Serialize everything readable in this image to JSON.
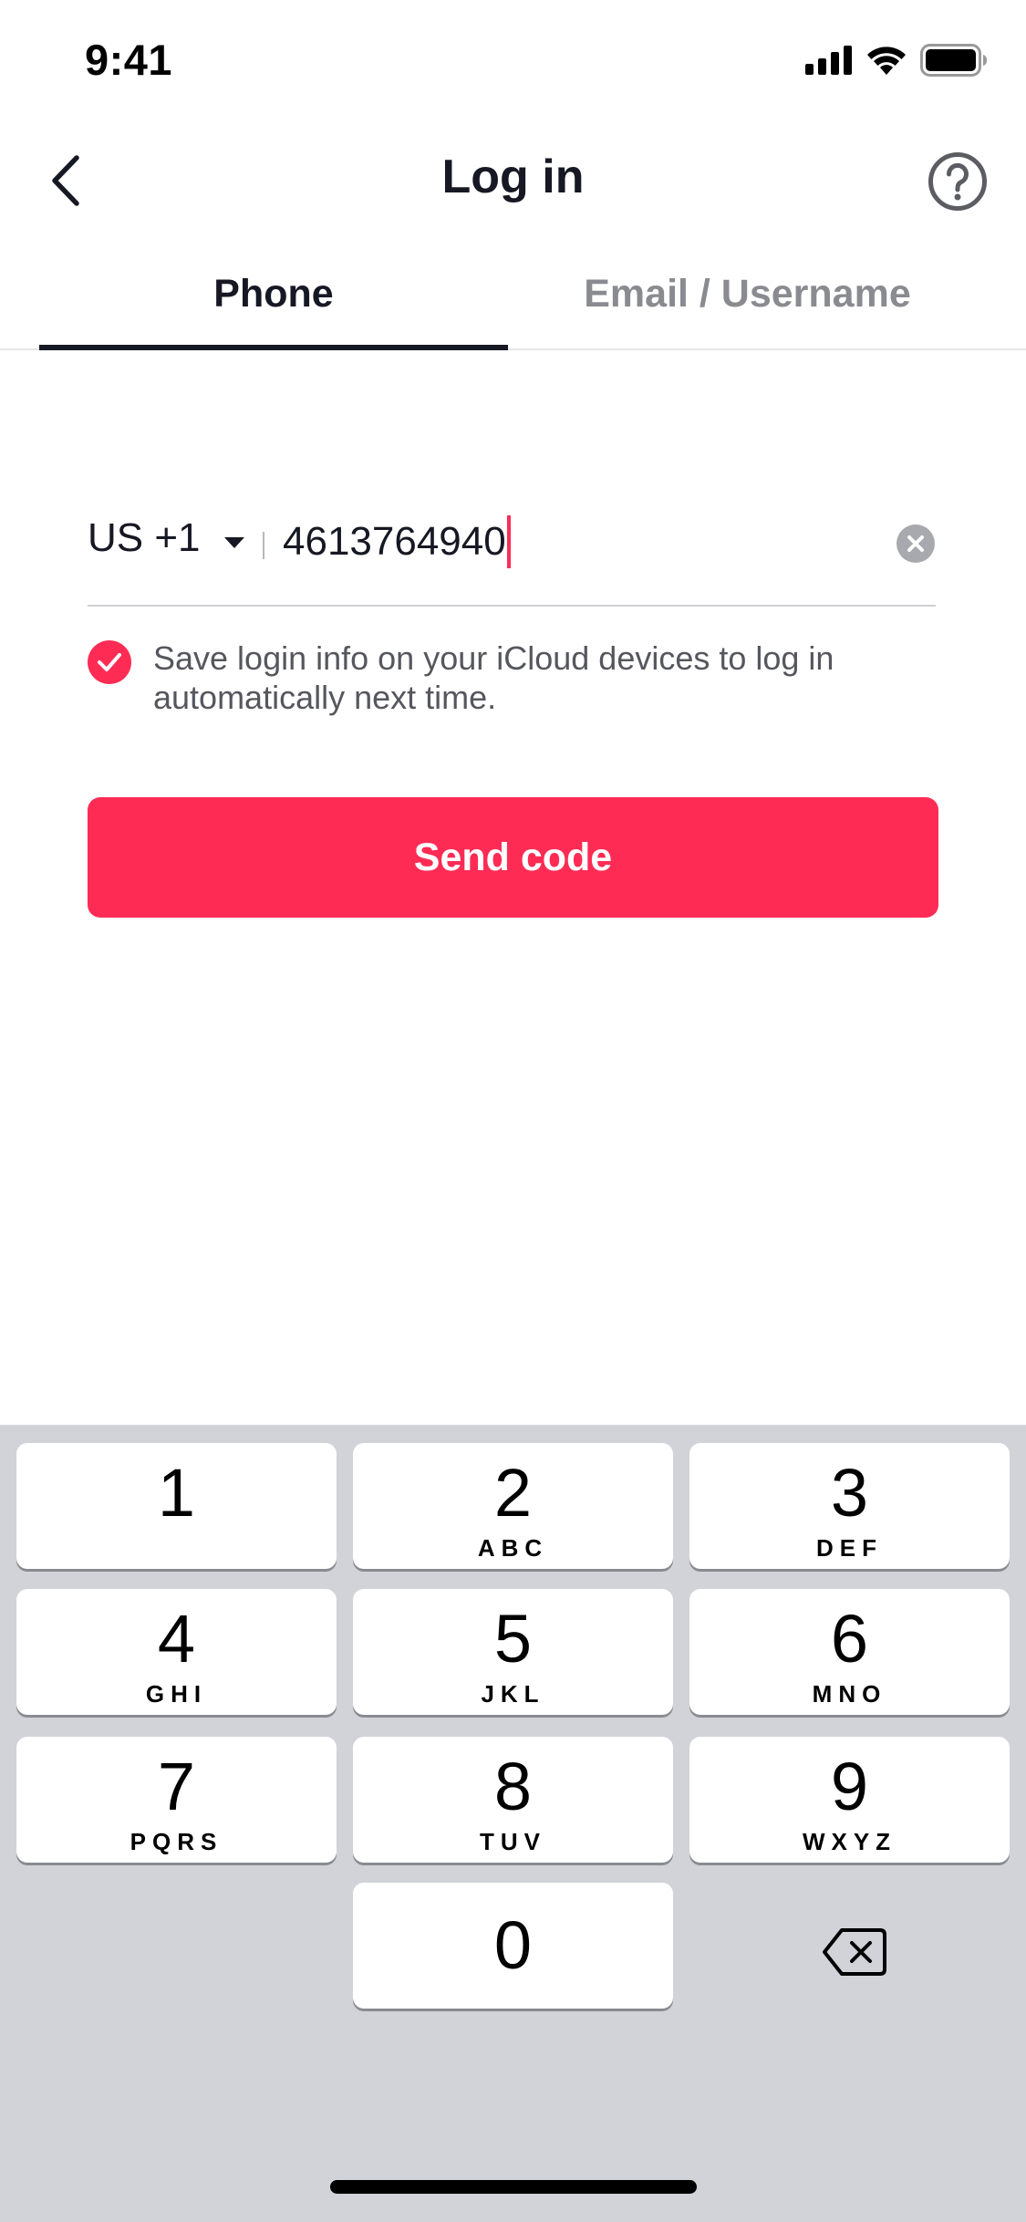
{
  "status_bar": {
    "time": "9:41",
    "icons": [
      "cellular-signal-icon",
      "wifi-icon",
      "battery-icon"
    ]
  },
  "header": {
    "back_icon": "chevron-left-icon",
    "title": "Log in",
    "help_icon": "question-circle-icon"
  },
  "tabs": [
    {
      "label": "Phone",
      "active": true
    },
    {
      "label": "Email / Username",
      "active": false
    }
  ],
  "phone_form": {
    "country_code": "US +1",
    "phone_number": "4613764940",
    "clear_icon": "clear-circle-icon"
  },
  "save_login": {
    "checked": true,
    "text": "Save login info on your iCloud devices to log in automatically next time."
  },
  "send_button": {
    "label": "Send code"
  },
  "keyboard": {
    "keys": [
      {
        "num": "1",
        "letters": ""
      },
      {
        "num": "2",
        "letters": "ABC"
      },
      {
        "num": "3",
        "letters": "DEF"
      },
      {
        "num": "4",
        "letters": "GHI"
      },
      {
        "num": "5",
        "letters": "JKL"
      },
      {
        "num": "6",
        "letters": "MNO"
      },
      {
        "num": "7",
        "letters": "PQRS"
      },
      {
        "num": "8",
        "letters": "TUV"
      },
      {
        "num": "9",
        "letters": "WXYZ"
      },
      {
        "num": "0",
        "letters": ""
      }
    ],
    "delete_icon": "backspace-icon"
  },
  "colors": {
    "accent": "#fe2c55",
    "text_primary": "#161823",
    "text_secondary": "#8a8b91",
    "keyboard_bg": "#d1d3d9"
  }
}
